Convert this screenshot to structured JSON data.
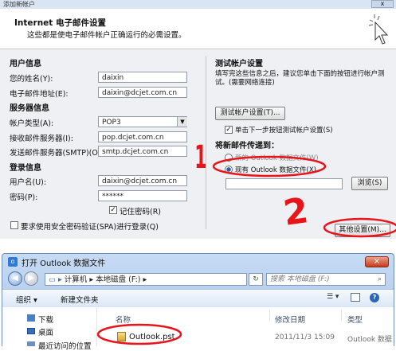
{
  "wizard": {
    "title": "添加新帐户",
    "header_title": "Internet 电子邮件设置",
    "header_subtitle": "这些都是使电子邮件帐户正确运行的必需设置。",
    "user_info": {
      "heading": "用户信息",
      "name_label": "您的姓名(Y):",
      "name_value": "daixin",
      "email_label": "电子邮件地址(E):",
      "email_value": "daixin@dcjet.com.cn"
    },
    "server_info": {
      "heading": "服务器信息",
      "account_type_label": "帐户类型(A):",
      "account_type_value": "POP3",
      "incoming_label": "接收邮件服务器(I):",
      "incoming_value": "pop.dcjet.com.cn",
      "outgoing_label": "发送邮件服务器(SMTP)(O):",
      "outgoing_value": "smtp.dcjet.com.cn"
    },
    "login_info": {
      "heading": "登录信息",
      "username_label": "用户名(U):",
      "username_value": "daixin@dcjet.com.cn",
      "password_label": "密码(P):",
      "password_value": "******",
      "remember_label": "记住密码(R)",
      "spa_label": "要求使用安全密码验证(SPA)进行登录(Q)"
    },
    "test": {
      "heading": "测试帐户设置",
      "description": "填写完这些信息之后，建议您单击下面的按钮进行帐户测试。(需要网络连接)",
      "test_button": "测试帐户设置(T)...",
      "next_test_label": "单击下一步按钮测试帐户设置(S)",
      "deliver_heading": "将新邮件传递到：",
      "new_pst_label": "新的 Outlook 数据文件(W)",
      "existing_pst_label": "现有 Outlook 数据文件(X)",
      "browse_button": "浏览(S)",
      "more_settings_button": "其他设置(M)..."
    },
    "annotation_one": "1",
    "annotation_two": "2"
  },
  "file_dialog": {
    "title": "打开 Outlook 数据文件",
    "breadcrumb": [
      "计算机",
      "本地磁盘 (F:)"
    ],
    "search_placeholder": "搜索 本地磁盘 (F:)",
    "organize_label": "组织 ▾",
    "new_folder_label": "新建文件夹",
    "sidebar": [
      "下载",
      "桌面",
      "最近访问的位置"
    ],
    "columns": [
      "名称",
      "修改日期",
      "类型"
    ],
    "file_name": "Outlook.pst",
    "file_date": "2011/11/3 15:09",
    "file_type": "Outlook 数据"
  },
  "colors": {
    "accent": "#e8141a",
    "frame": "#c9d9ee",
    "dialog_blue": "#2e6ec2"
  }
}
